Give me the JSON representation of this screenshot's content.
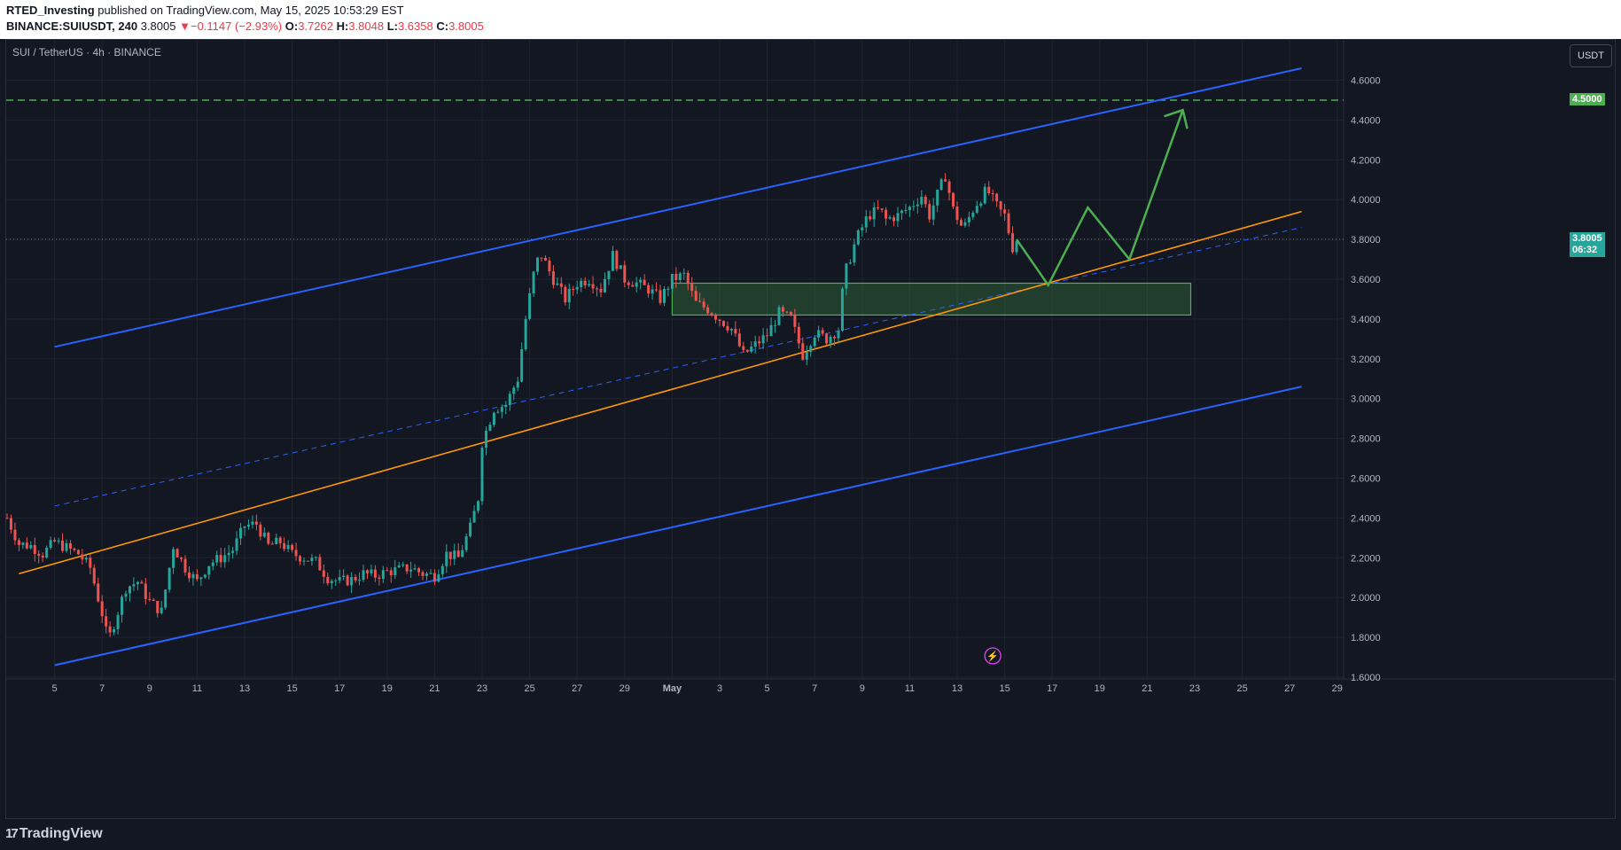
{
  "header": {
    "publisher": "RTED_Investing",
    "published_text": " published on TradingView.com, May 15, 2025 10:53:29 EST",
    "symbol_full": "BINANCE:SUIUSDT, 240",
    "last": "3.8005",
    "change_arrow": "▼",
    "change": "−0.1147 (−2.93%)",
    "o_label": "O:",
    "o_val": "3.7262",
    "h_label": "H:",
    "h_val": "3.8048",
    "l_label": "L:",
    "l_val": "3.6358",
    "c_label": "C:",
    "c_val": "3.8005"
  },
  "chart_title": "SUI / TetherUS · 4h · BINANCE",
  "currency_button": "USDT",
  "footer": {
    "logo_mark": "17",
    "logo_text": "TradingView"
  },
  "colors": {
    "background": "#131722",
    "up": "#26a69a",
    "down": "#ef5350",
    "channel": "#2962ff",
    "support": "#ff9800",
    "target": "#4caf50",
    "zone": "#4caf50"
  },
  "chart_data": {
    "type": "candlestick",
    "title": "SUI / TetherUS · 4h · BINANCE",
    "y_axis": {
      "ylim": [
        1.6,
        4.72
      ],
      "ticks": [
        "1.6000",
        "1.8000",
        "2.0000",
        "2.2000",
        "2.4000",
        "2.6000",
        "2.8000",
        "3.0000",
        "3.2000",
        "3.4000",
        "3.6000",
        "3.8000",
        "4.0000",
        "4.2000",
        "4.4000",
        "4.6000"
      ]
    },
    "x_axis": {
      "range": [
        "2025-04-03",
        "2025-04-29+30"
      ],
      "ticks": [
        {
          "date": "2025-04-05",
          "label": "5"
        },
        {
          "date": "2025-04-07",
          "label": "7"
        },
        {
          "date": "2025-04-09",
          "label": "9"
        },
        {
          "date": "2025-04-11",
          "label": "11"
        },
        {
          "date": "2025-04-13",
          "label": "13"
        },
        {
          "date": "2025-04-15",
          "label": "15"
        },
        {
          "date": "2025-04-17",
          "label": "17"
        },
        {
          "date": "2025-04-19",
          "label": "19"
        },
        {
          "date": "2025-04-21",
          "label": "21"
        },
        {
          "date": "2025-04-23",
          "label": "23"
        },
        {
          "date": "2025-04-25",
          "label": "25"
        },
        {
          "date": "2025-04-27",
          "label": "27"
        },
        {
          "date": "2025-04-29",
          "label": "29"
        },
        {
          "date": "2025-05-01",
          "label": "May",
          "bold": true
        },
        {
          "date": "2025-05-03",
          "label": "3"
        },
        {
          "date": "2025-05-05",
          "label": "5"
        },
        {
          "date": "2025-05-07",
          "label": "7"
        },
        {
          "date": "2025-05-09",
          "label": "9"
        },
        {
          "date": "2025-05-11",
          "label": "11"
        },
        {
          "date": "2025-05-13",
          "label": "13"
        },
        {
          "date": "2025-05-15",
          "label": "15"
        },
        {
          "date": "2025-05-17",
          "label": "17"
        },
        {
          "date": "2025-05-19",
          "label": "19"
        },
        {
          "date": "2025-05-21",
          "label": "21"
        },
        {
          "date": "2025-05-23",
          "label": "23"
        },
        {
          "date": "2025-05-25",
          "label": "25"
        },
        {
          "date": "2025-05-27",
          "label": "27"
        },
        {
          "date": "2025-05-29",
          "label": "29"
        }
      ]
    },
    "price_path": [
      [
        "2025-04-03T00:00",
        2.4
      ],
      [
        "2025-04-03T12:00",
        2.27
      ],
      [
        "2025-04-04T00:00",
        2.26
      ],
      [
        "2025-04-04T12:00",
        2.22
      ],
      [
        "2025-04-05T00:00",
        2.28
      ],
      [
        "2025-04-05T12:00",
        2.25
      ],
      [
        "2025-04-06T00:00",
        2.22
      ],
      [
        "2025-04-06T12:00",
        2.15
      ],
      [
        "2025-04-07T00:00",
        1.92
      ],
      [
        "2025-04-07T06:00",
        1.78
      ],
      [
        "2025-04-07T14:00",
        1.9
      ],
      [
        "2025-04-08T00:00",
        2.05
      ],
      [
        "2025-04-08T12:00",
        2.08
      ],
      [
        "2025-04-09T00:00",
        1.98
      ],
      [
        "2025-04-09T12:00",
        1.93
      ],
      [
        "2025-04-10T00:00",
        2.26
      ],
      [
        "2025-04-10T12:00",
        2.15
      ],
      [
        "2025-04-11T00:00",
        2.08
      ],
      [
        "2025-04-11T12:00",
        2.17
      ],
      [
        "2025-04-12T00:00",
        2.2
      ],
      [
        "2025-04-12T12:00",
        2.24
      ],
      [
        "2025-04-13T00:00",
        2.36
      ],
      [
        "2025-04-13T12:00",
        2.37
      ],
      [
        "2025-04-14T00:00",
        2.26
      ],
      [
        "2025-04-14T12:00",
        2.28
      ],
      [
        "2025-04-15T00:00",
        2.22
      ],
      [
        "2025-04-15T12:00",
        2.2
      ],
      [
        "2025-04-16T00:00",
        2.18
      ],
      [
        "2025-04-16T12:00",
        2.1
      ],
      [
        "2025-04-17T00:00",
        2.08
      ],
      [
        "2025-04-17T12:00",
        2.09
      ],
      [
        "2025-04-18T00:00",
        2.12
      ],
      [
        "2025-04-18T12:00",
        2.11
      ],
      [
        "2025-04-19T00:00",
        2.13
      ],
      [
        "2025-04-19T12:00",
        2.14
      ],
      [
        "2025-04-20T00:00",
        2.15
      ],
      [
        "2025-04-20T12:00",
        2.12
      ],
      [
        "2025-04-21T00:00",
        2.11
      ],
      [
        "2025-04-21T12:00",
        2.22
      ],
      [
        "2025-04-22T00:00",
        2.2
      ],
      [
        "2025-04-22T12:00",
        2.35
      ],
      [
        "2025-04-22T20:00",
        2.5
      ],
      [
        "2025-04-23T00:00",
        2.78
      ],
      [
        "2025-04-23T12:00",
        2.95
      ],
      [
        "2025-04-24T00:00",
        2.97
      ],
      [
        "2025-04-24T12:00",
        3.1
      ],
      [
        "2025-04-24T20:00",
        3.4
      ],
      [
        "2025-04-25T06:00",
        3.68
      ],
      [
        "2025-04-25T12:00",
        3.72
      ],
      [
        "2025-04-26T00:00",
        3.6
      ],
      [
        "2025-04-26T12:00",
        3.5
      ],
      [
        "2025-04-27T00:00",
        3.58
      ],
      [
        "2025-04-27T12:00",
        3.6
      ],
      [
        "2025-04-28T00:00",
        3.55
      ],
      [
        "2025-04-28T12:00",
        3.72
      ],
      [
        "2025-04-29T00:00",
        3.6
      ],
      [
        "2025-04-29T12:00",
        3.58
      ],
      [
        "2025-04-30T00:00",
        3.55
      ],
      [
        "2025-04-30T12:00",
        3.5
      ],
      [
        "2025-05-01T00:00",
        3.6
      ],
      [
        "2025-05-01T12:00",
        3.62
      ],
      [
        "2025-05-02T00:00",
        3.48
      ],
      [
        "2025-05-02T12:00",
        3.45
      ],
      [
        "2025-05-03T00:00",
        3.4
      ],
      [
        "2025-05-03T12:00",
        3.35
      ],
      [
        "2025-05-04T00:00",
        3.22
      ],
      [
        "2025-05-04T12:00",
        3.27
      ],
      [
        "2025-05-05T00:00",
        3.32
      ],
      [
        "2025-05-05T12:00",
        3.43
      ],
      [
        "2025-05-06T00:00",
        3.4
      ],
      [
        "2025-05-06T12:00",
        3.22
      ],
      [
        "2025-05-07T00:00",
        3.33
      ],
      [
        "2025-05-07T12:00",
        3.3
      ],
      [
        "2025-05-08T00:00",
        3.35
      ],
      [
        "2025-05-08T06:00",
        3.62
      ],
      [
        "2025-05-08T18:00",
        3.8
      ],
      [
        "2025-05-09T06:00",
        3.92
      ],
      [
        "2025-05-09T18:00",
        3.95
      ],
      [
        "2025-05-10T00:00",
        3.9
      ],
      [
        "2025-05-10T12:00",
        3.92
      ],
      [
        "2025-05-11T00:00",
        3.96
      ],
      [
        "2025-05-11T12:00",
        4.02
      ],
      [
        "2025-05-11T20:00",
        3.92
      ],
      [
        "2025-05-12T06:00",
        4.05
      ],
      [
        "2025-05-12T12:00",
        4.12
      ],
      [
        "2025-05-12T20:00",
        3.95
      ],
      [
        "2025-05-13T06:00",
        3.85
      ],
      [
        "2025-05-13T18:00",
        3.97
      ],
      [
        "2025-05-14T06:00",
        4.05
      ],
      [
        "2025-05-14T18:00",
        3.95
      ],
      [
        "2025-05-15T00:00",
        3.92
      ],
      [
        "2025-05-15T08:00",
        3.76
      ],
      [
        "2025-05-15T12:00",
        3.8
      ]
    ],
    "last_price": 3.8005,
    "last_price_tag": {
      "price": "3.8005",
      "countdown": "06:32"
    },
    "target_level": {
      "price": 4.5,
      "label": "4.5000"
    },
    "demand_zone": {
      "from": "2025-05-01",
      "to": "2025-05-22T20:00",
      "low": 3.42,
      "high": 3.58
    },
    "channel_upper": {
      "from": [
        "2025-04-05",
        3.26
      ],
      "to": [
        "2025-05-27T12:00",
        4.66
      ]
    },
    "channel_lower": {
      "from": [
        "2025-04-05",
        1.66
      ],
      "to": [
        "2025-05-27T12:00",
        3.06
      ]
    },
    "channel_mid": {
      "from": [
        "2025-04-05",
        2.46
      ],
      "to": [
        "2025-05-27T12:00",
        3.86
      ]
    },
    "support_line": {
      "from": [
        "2025-04-03T12:00",
        2.12
      ],
      "to": [
        "2025-05-27T12:00",
        3.94
      ]
    },
    "projection_path": [
      [
        "2025-05-15T12:00",
        3.8
      ],
      [
        "2025-05-16T20:00",
        3.57
      ],
      [
        "2025-05-18T12:00",
        3.96
      ],
      [
        "2025-05-20T06:00",
        3.7
      ],
      [
        "2025-05-22T12:00",
        4.45
      ]
    ],
    "grid": true
  }
}
